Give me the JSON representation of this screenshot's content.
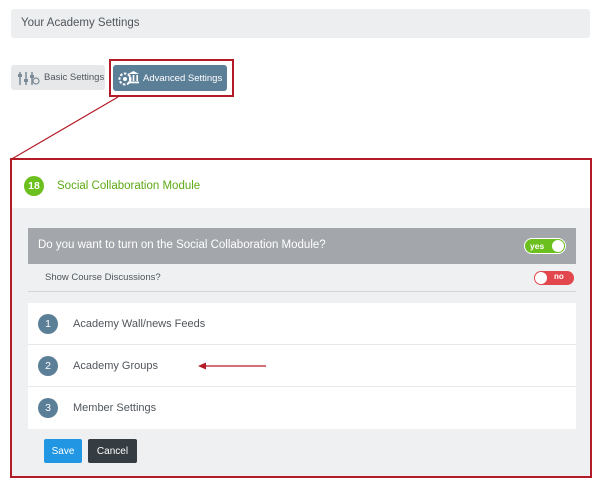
{
  "header": {
    "title": "Your Academy Settings"
  },
  "tabs": {
    "basic": {
      "label": "Basic Settings",
      "icon": "settings-sliders-icon"
    },
    "advanced": {
      "label": "Advanced Settings",
      "icon": "gear-institution-icon",
      "active": true
    }
  },
  "module": {
    "step": "18",
    "title": "Social Collaboration Module",
    "question": "Do you want to turn on the Social Collaboration Module?",
    "toggle_on": {
      "label": "yes",
      "state": true
    },
    "discussions": {
      "label": "Show Course Discussions?",
      "toggle": {
        "label": "no",
        "state": false
      }
    },
    "items": [
      {
        "number": "1",
        "label": "Academy Wall/news Feeds"
      },
      {
        "number": "2",
        "label": "Academy Groups"
      },
      {
        "number": "3",
        "label": "Member Settings"
      }
    ]
  },
  "buttons": {
    "save": "Save",
    "cancel": "Cancel"
  },
  "colors": {
    "accent_green": "#6cc01d",
    "highlight_red": "#b31b26",
    "active_tab": "#5c7f98",
    "save_blue": "#2196e3",
    "cancel_dark": "#353c42",
    "toggle_off_red": "#e2474d"
  }
}
